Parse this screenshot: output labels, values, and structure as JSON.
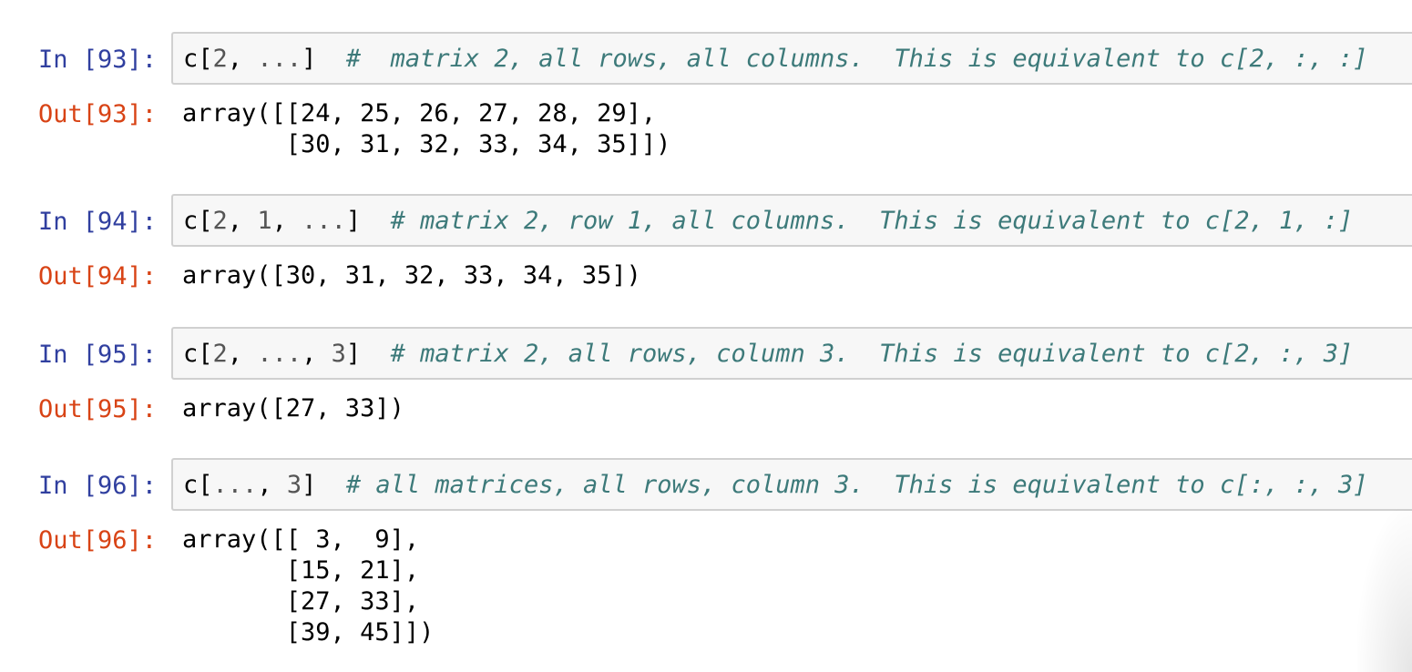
{
  "cells": [
    {
      "in_prompt": "In [93]:",
      "code": {
        "name": "c",
        "open": "[",
        "arg1": "2",
        "sep1": ", ",
        "arg2": "...",
        "close": "]",
        "gap": "  ",
        "comment": "#  matrix 2, all rows, all columns.  This is equivalent to c[2, :, :]"
      },
      "out_prompt": "Out[93]:",
      "output": "array([[24, 25, 26, 27, 28, 29],\n       [30, 31, 32, 33, 34, 35]])"
    },
    {
      "in_prompt": "In [94]:",
      "code": {
        "name": "c",
        "open": "[",
        "arg1": "2",
        "sep1": ", ",
        "arg2": "1",
        "sep2": ", ",
        "arg3": "...",
        "close": "]",
        "gap": "  ",
        "comment": "# matrix 2, row 1, all columns.  This is equivalent to c[2, 1, :]"
      },
      "out_prompt": "Out[94]:",
      "output": "array([30, 31, 32, 33, 34, 35])"
    },
    {
      "in_prompt": "In [95]:",
      "code": {
        "name": "c",
        "open": "[",
        "arg1": "2",
        "sep1": ", ",
        "arg2": "...",
        "sep2": ", ",
        "arg3": "3",
        "close": "]",
        "gap": "  ",
        "comment": "# matrix 2, all rows, column 3.  This is equivalent to c[2, :, 3]"
      },
      "out_prompt": "Out[95]:",
      "output": "array([27, 33])"
    },
    {
      "in_prompt": "In [96]:",
      "code": {
        "name": "c",
        "open": "[",
        "arg1": "...",
        "sep1": ", ",
        "arg2": "3",
        "close": "]",
        "gap": "  ",
        "comment": "# all matrices, all rows, column 3.  This is equivalent to c[:, :, 3]"
      },
      "out_prompt": "Out[96]:",
      "output": "array([[ 3,  9],\n       [15, 21],\n       [27, 33],\n       [39, 45]])"
    }
  ],
  "colors": {
    "in_prompt": "#303f9f",
    "out_prompt": "#d84315",
    "comment": "#3d7a7a",
    "input_background": "#f7f7f7",
    "input_border": "#d0d0d0"
  }
}
